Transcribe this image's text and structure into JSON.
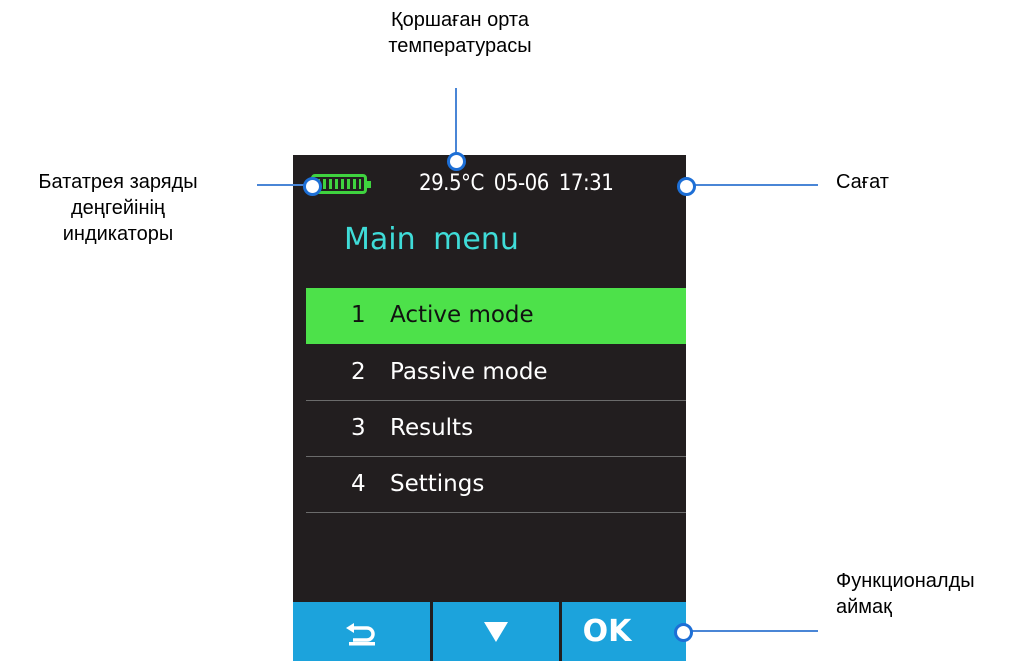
{
  "callouts": {
    "temperature_line1": "Қоршаған орта",
    "temperature_line2": "температурасы",
    "battery_line1": "Бататрея заряды",
    "battery_line2": "деңгейінің",
    "battery_line3": "индикаторы",
    "clock": "Сағат",
    "functional_line1": "Функционалды",
    "functional_line2": "аймақ"
  },
  "screen": {
    "status": {
      "temperature": "29.5°C",
      "date": "05-06",
      "time": "17:31"
    },
    "title": "Main menu",
    "menu_items": [
      {
        "number": "1",
        "label": "Active mode",
        "selected": true
      },
      {
        "number": "2",
        "label": "Passive mode",
        "selected": false
      },
      {
        "number": "3",
        "label": "Results",
        "selected": false
      },
      {
        "number": "4",
        "label": "Settings",
        "selected": false
      }
    ],
    "buttons": {
      "back_icon": "back-arrow-icon",
      "down_icon": "down-triangle-icon",
      "ok": "OK"
    }
  },
  "colors": {
    "selected_item": "#4de14a",
    "title": "#3fdcd8",
    "function_bar": "#1ca3dc",
    "screen_background": "#221e1f",
    "callout_line": "#1d6fd6"
  }
}
